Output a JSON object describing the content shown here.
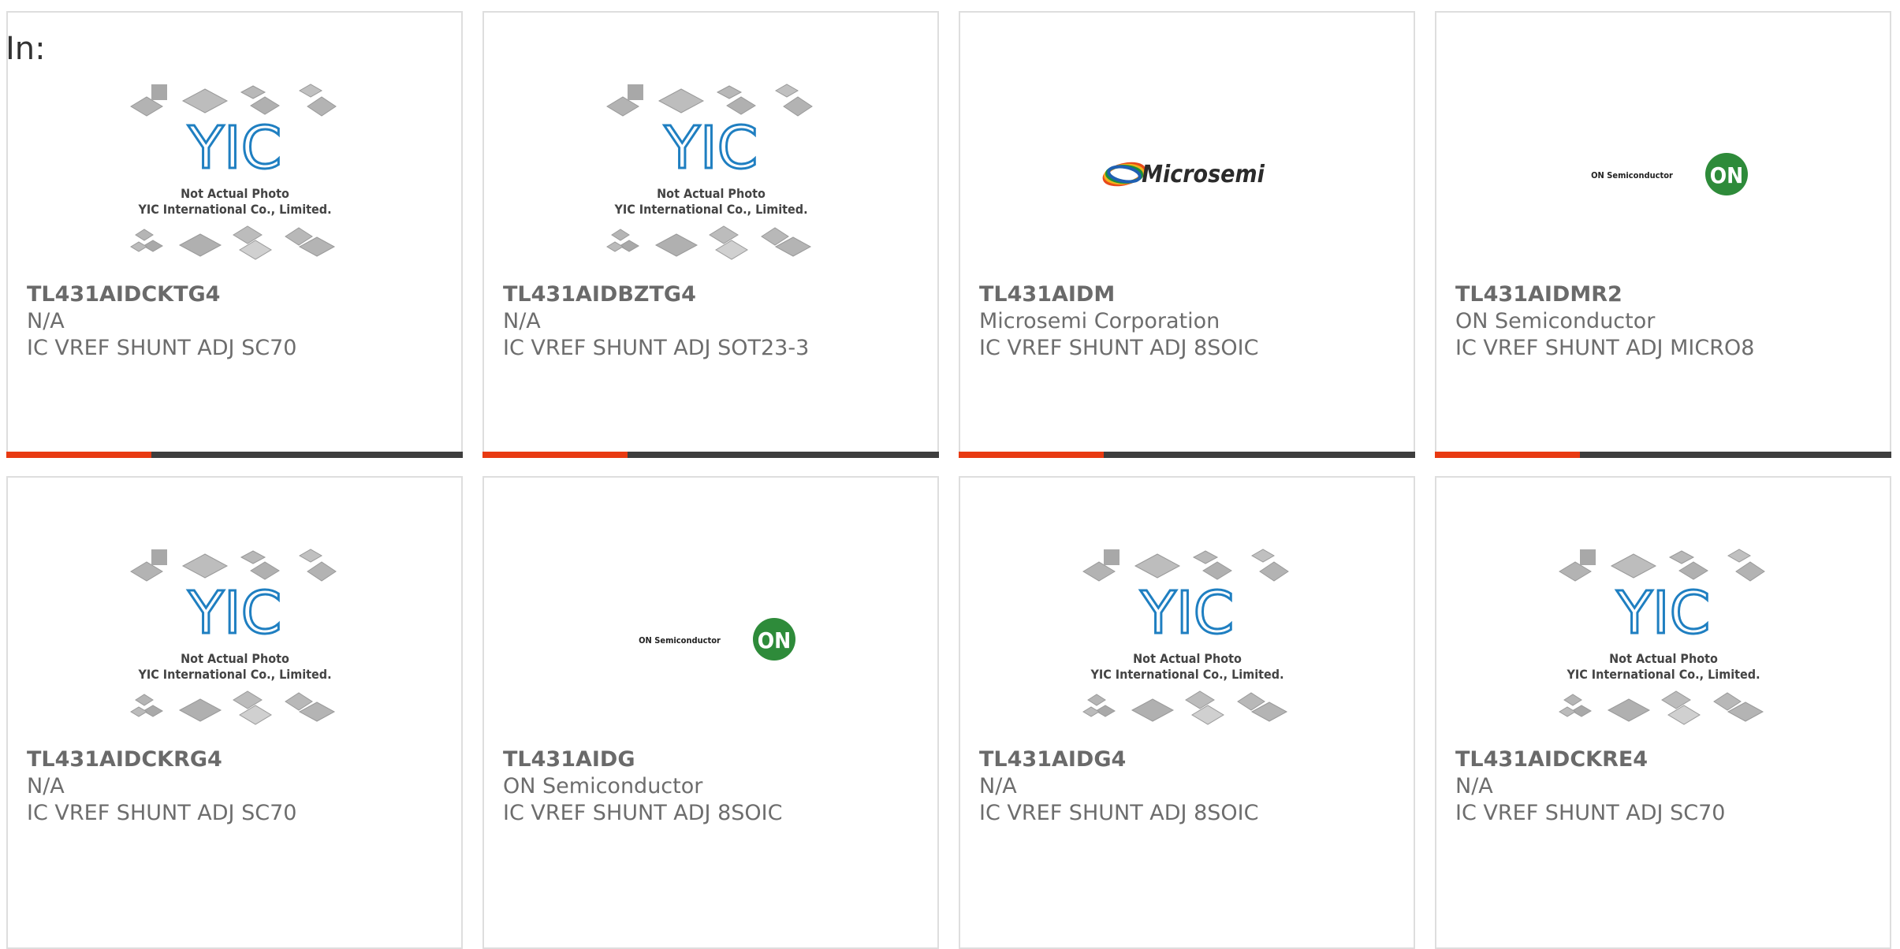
{
  "header": {
    "label": "In:"
  },
  "placeholder_image": {
    "line1": "Not Actual Photo",
    "line2": "YIC International Co., Limited.",
    "logo_text": "YIC"
  },
  "logos": {
    "microsemi": "Microsemi",
    "on_semi_wordmark": "ON Semiconductor",
    "on_semi_badge": "ON"
  },
  "colors": {
    "accent": "#e83a12",
    "bar_dark": "#3e3e3e",
    "yic_blue": "#1f7fc1",
    "on_green": "#2e8b3a"
  },
  "products": [
    {
      "part": "TL431AIDCKTG4",
      "manufacturer": "N/A",
      "description": "IC VREF SHUNT ADJ SC70",
      "image": "yic-placeholder"
    },
    {
      "part": "TL431AIDBZTG4",
      "manufacturer": "N/A",
      "description": "IC VREF SHUNT ADJ SOT23-3",
      "image": "yic-placeholder"
    },
    {
      "part": "TL431AIDM",
      "manufacturer": "Microsemi Corporation",
      "description": "IC VREF SHUNT ADJ 8SOIC",
      "image": "microsemi-logo"
    },
    {
      "part": "TL431AIDMR2",
      "manufacturer": "ON Semiconductor",
      "description": "IC VREF SHUNT ADJ MICRO8",
      "image": "on-semi-logo"
    },
    {
      "part": "TL431AIDCKRG4",
      "manufacturer": "N/A",
      "description": "IC VREF SHUNT ADJ SC70",
      "image": "yic-placeholder"
    },
    {
      "part": "TL431AIDG",
      "manufacturer": "ON Semiconductor",
      "description": "IC VREF SHUNT ADJ 8SOIC",
      "image": "on-semi-logo"
    },
    {
      "part": "TL431AIDG4",
      "manufacturer": "N/A",
      "description": "IC VREF SHUNT ADJ 8SOIC",
      "image": "yic-placeholder"
    },
    {
      "part": "TL431AIDCKRE4",
      "manufacturer": "N/A",
      "description": "IC VREF SHUNT ADJ SC70",
      "image": "yic-placeholder"
    }
  ]
}
